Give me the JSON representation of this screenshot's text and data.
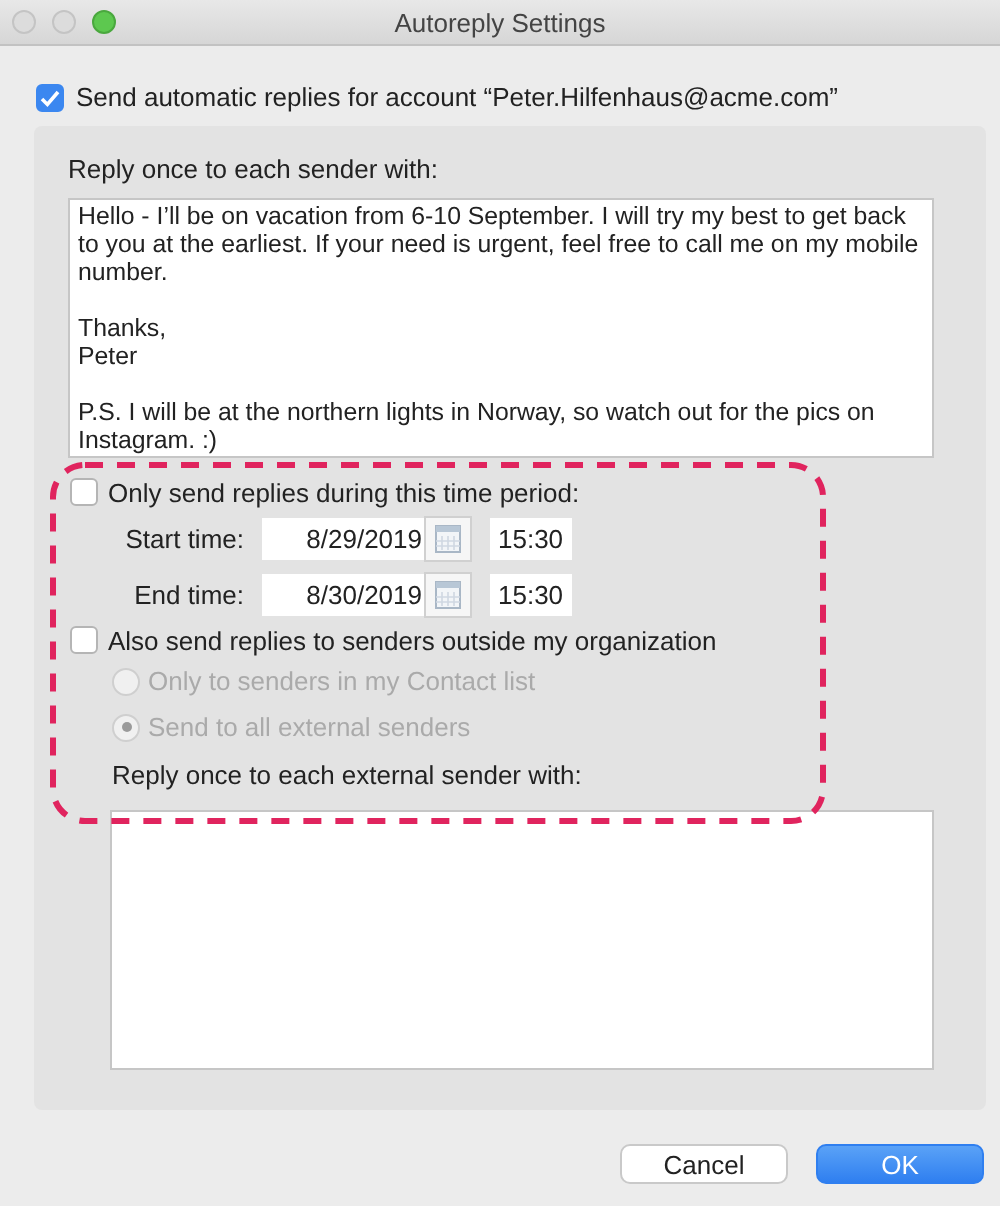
{
  "window": {
    "title": "Autoreply Settings",
    "traffic_lights": [
      {
        "kind": "close",
        "color": "#dcdcdc"
      },
      {
        "kind": "minimize",
        "color": "#dcdcdc"
      },
      {
        "kind": "zoom",
        "color": "#5dc84f"
      }
    ]
  },
  "enable": {
    "label": "Send automatic replies for account “Peter.Hilfenhaus@acme.com”",
    "checked": true
  },
  "reply": {
    "label": "Reply once to each sender with:",
    "value": "Hello - I’ll be on vacation from 6-10 September. I will try my best to get back to you at the earliest. If your need is urgent, feel free to call me on my mobile number.\n\nThanks,\nPeter\n\nP.S. I will be at the northern lights in Norway, so watch out for the pics on Instagram. :)"
  },
  "time_period": {
    "label": "Only send replies during this time period:",
    "checked": false,
    "rows": [
      {
        "label": "Start time:",
        "date": "8/29/2019",
        "time": "15:30"
      },
      {
        "label": "End time:",
        "date": "8/30/2019",
        "time": "15:30"
      }
    ]
  },
  "external": {
    "label": "Also send replies to senders outside my organization",
    "checked": false,
    "options": [
      {
        "label": "Only to senders in my Contact list",
        "selected": false,
        "disabled": true
      },
      {
        "label": "Send to all external senders",
        "selected": true,
        "disabled": true
      }
    ],
    "reply_label": "Reply once to each external sender with:"
  },
  "highlight": {
    "color": "#e0245e"
  },
  "buttons": [
    {
      "label": "Cancel",
      "kind": "secondary"
    },
    {
      "label": "OK",
      "kind": "primary"
    }
  ]
}
